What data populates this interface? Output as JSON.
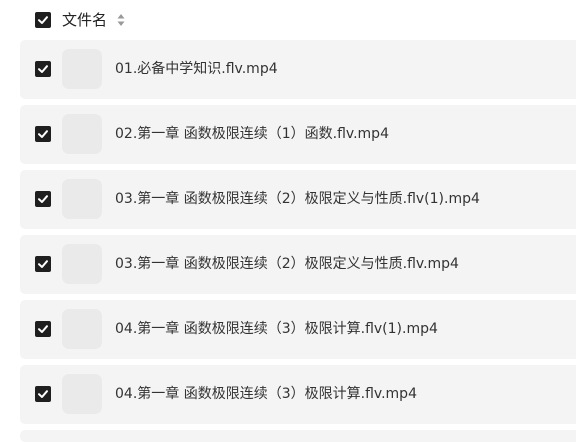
{
  "header": {
    "select_all_checked": true,
    "column_label": "文件名",
    "sort_icon": "sort-updown-icon"
  },
  "files": [
    {
      "name": "01.必备中学知识.flv.mp4",
      "checked": true
    },
    {
      "name": "02.第一章 函数极限连续（1）函数.flv.mp4",
      "checked": true
    },
    {
      "name": "03.第一章 函数极限连续（2）极限定义与性质.flv(1).mp4",
      "checked": true
    },
    {
      "name": "03.第一章 函数极限连续（2）极限定义与性质.flv.mp4",
      "checked": true
    },
    {
      "name": "04.第一章 函数极限连续（3）极限计算.flv(1).mp4",
      "checked": true
    },
    {
      "name": "04.第一章 函数极限连续（3）极限计算.flv.mp4",
      "checked": true
    }
  ],
  "colors": {
    "row_background": "#f4f4f4",
    "thumbnail_placeholder": "#eaeaea",
    "checkbox_fill": "#1f1f1f",
    "text": "#333333"
  }
}
